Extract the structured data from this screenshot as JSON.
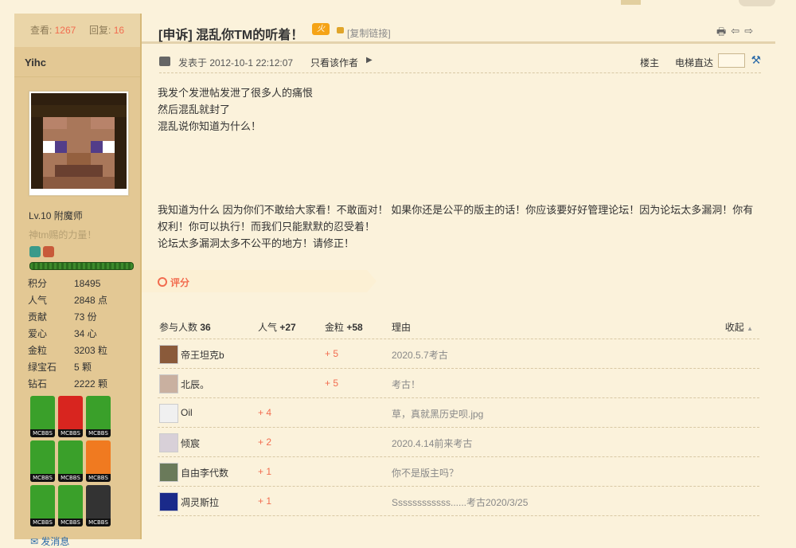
{
  "sidebar": {
    "views_label": "查看:",
    "views": "1267",
    "replies_label": "回复:",
    "replies": "16",
    "username": "Yihc",
    "level": "Lv.10 附魔师",
    "subtitle": "神tm赐的力量！",
    "stats": [
      {
        "k": "积分",
        "v": "18495"
      },
      {
        "k": "人气",
        "v": "2848 点"
      },
      {
        "k": "贡献",
        "v": "73 份"
      },
      {
        "k": "爱心",
        "v": "34 心"
      },
      {
        "k": "金粒",
        "v": "3203 粒"
      },
      {
        "k": "绿宝石",
        "v": "5 颗"
      },
      {
        "k": "钻石",
        "v": "2222 颗"
      }
    ],
    "badge_label": "MCBBS",
    "send_message": "发消息"
  },
  "thread": {
    "title": "[申诉] 混乱你TM的听着！",
    "hot_icon": "火",
    "copy_link": "[复制链接]",
    "posted_at": "发表于 2012-10-1 22:12:07",
    "only_author": "只看该作者",
    "floor": "楼主",
    "elevator": "电梯直达"
  },
  "post": {
    "lines1": [
      "我发个发泄帖发泄了很多人的痛恨",
      "然后混乱就封了",
      "混乱说你知道为什么！"
    ],
    "lines2": [
      "我知道为什么   因为你们不敢给大家看！不敢面对！  如果你还是公平的版主的话！你应该要好好管理论坛！因为论坛太多漏洞！你有权利！你可以执行！而我们只能默默的忍受着！",
      "论坛太多漏洞太多不公平的地方！请修正！"
    ]
  },
  "rating": {
    "header": "评分",
    "col_people": "参与人数",
    "people": "36",
    "col_pop": "人气",
    "pop_total": "+27",
    "col_gold": "金粒",
    "gold_total": "+58",
    "col_reason": "理由",
    "collapse": "收起",
    "rows": [
      {
        "name": "帝王坦克b",
        "pop": "",
        "gold": "+ 5",
        "reason": "2020.5.7考古",
        "color": "#8a5a3a"
      },
      {
        "name": "北辰。",
        "pop": "",
        "gold": "+ 5",
        "reason": "考古！",
        "color": "#c9b0a0"
      },
      {
        "name": "Oil",
        "pop": "+ 4",
        "gold": "",
        "reason": "草，真就黑历史呗.jpg",
        "color": "#f0f0f0"
      },
      {
        "name": "倾宸",
        "pop": "+ 2",
        "gold": "",
        "reason": "2020.4.14前来考古",
        "color": "#d8d0d8"
      },
      {
        "name": "自由李代数",
        "pop": "+ 1",
        "gold": "",
        "reason": "你不是版主吗？",
        "color": "#6a7a5a"
      },
      {
        "name": "凋灵斯拉",
        "pop": "+ 1",
        "gold": "",
        "reason": "Ssssssssssss......考古2020/3/25",
        "color": "#1a2a8a"
      }
    ]
  }
}
